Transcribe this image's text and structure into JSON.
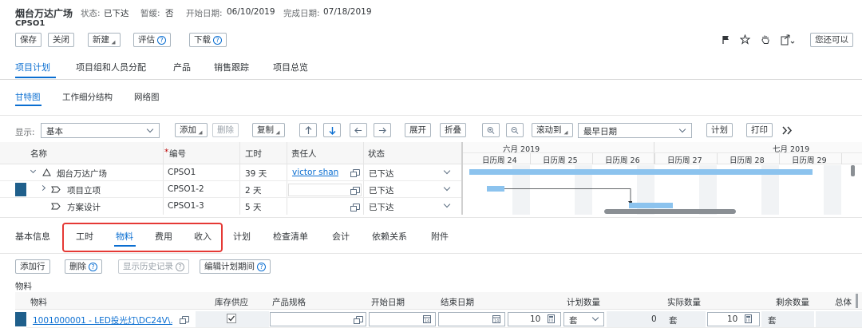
{
  "header": {
    "title": "烟台万达广场",
    "subtitle": "CPSO1",
    "status_label": "状态:",
    "status_value": "已下达",
    "pause_label": "暂缓:",
    "pause_value": "否",
    "start_label": "开始日期:",
    "start_value": "06/10/2019",
    "end_label": "完成日期:",
    "end_value": "07/18/2019"
  },
  "toolbar": {
    "save": "保存",
    "close": "关闭",
    "new": "新建",
    "evaluate": "评估",
    "download": "下载",
    "can_you": "您还可以"
  },
  "main_tabs": [
    "项目计划",
    "项目组和人员分配",
    "产品",
    "销售跟踪",
    "项目总览"
  ],
  "sub_tabs": [
    "甘特图",
    "工作细分结构",
    "网络图"
  ],
  "gantt_toolbar": {
    "display_label": "显示:",
    "display_value": "基本",
    "add": "添加",
    "delete": "删除",
    "copy": "复制",
    "expand": "展开",
    "collapse": "折叠",
    "scroll_to": "滚动到",
    "date_value": "最早日期",
    "plan": "计划",
    "print": "打印"
  },
  "gantt_table": {
    "headers": {
      "name": "名称",
      "number_star": "*",
      "number": "编号",
      "work": "工时",
      "owner": "责任人",
      "status": "状态"
    },
    "rows": [
      {
        "name": "烟台万达广场",
        "number": "CPSO1",
        "work": "39 天",
        "owner": "victor shan",
        "status": "已下达"
      },
      {
        "name": "项目立项",
        "number": "CPSO1-2",
        "work": "2 天",
        "owner": "",
        "status": "已下达"
      },
      {
        "name": "方案设计",
        "number": "CPSO1-3",
        "work": "5 天",
        "owner": "",
        "status": "已下达"
      }
    ]
  },
  "timeline": {
    "months": [
      "六月 2019",
      "七月 2019"
    ],
    "weeks": [
      "日历周 24",
      "日历周 25",
      "日历周 26",
      "日历周 27",
      "日历周 28",
      "日历周 29"
    ]
  },
  "detail_tabs": [
    "基本信息",
    "工时",
    "物料",
    "费用",
    "收入",
    "计划",
    "检查清单",
    "会计",
    "依赖关系",
    "附件"
  ],
  "material_toolbar": {
    "add_row": "添加行",
    "delete": "删除",
    "show_history": "显示历史记录",
    "edit_period": "编辑计划期间"
  },
  "material_section_title": "物料",
  "material_table": {
    "headers": [
      "物料",
      "库存供应",
      "产品规格",
      "开始日期",
      "结束日期",
      "计划数量",
      "实际数量",
      "剩余数量",
      "总体"
    ],
    "row": {
      "material": "1001000001 - LED投光灯\\DC24V\\...",
      "planned_qty": "10",
      "planned_unit": "套",
      "actual_qty": "0",
      "actual_unit": "套",
      "remaining_qty": "10",
      "remaining_unit": "套"
    }
  },
  "colors": {
    "accent": "#0a6ed1",
    "highlight_box": "#e53935",
    "bar": "#8cc3ee",
    "row_marker": "#1f5f8b"
  }
}
